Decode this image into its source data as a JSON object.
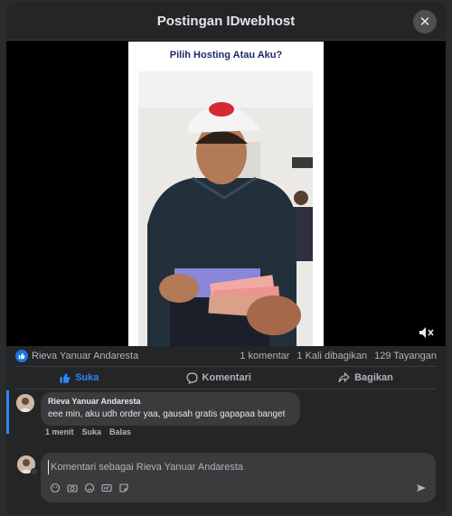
{
  "modal": {
    "title": "Postingan IDwebhost",
    "close_icon": "close-icon"
  },
  "video": {
    "heading": "Pilih Hosting Atau Aku?",
    "mute_icon": "speaker-muted-icon",
    "colors": {
      "heading": "#1f2a6b",
      "accent": "#1b74e4"
    }
  },
  "stats": {
    "reactor": "Rieva Yanuar Andaresta",
    "comments": "1 komentar",
    "shares": "1 Kali dibagikan",
    "views": "129 Tayangan"
  },
  "actions": {
    "like": "Suka",
    "comment": "Komentari",
    "share": "Bagikan"
  },
  "comment": {
    "author": "Rieva Yanuar Andaresta",
    "text": "eee min, aku udh order yaa, gausah gratis gapapaa banget",
    "time": "1 menit",
    "like": "Suka",
    "reply": "Balas"
  },
  "composer": {
    "placeholder": "Komentari sebagai Rieva Yanuar Andaresta",
    "icons": [
      "avatar-sticker-icon",
      "camera-icon",
      "emoji-icon",
      "gif-icon",
      "sticker-icon"
    ],
    "send_icon": "send-icon"
  }
}
